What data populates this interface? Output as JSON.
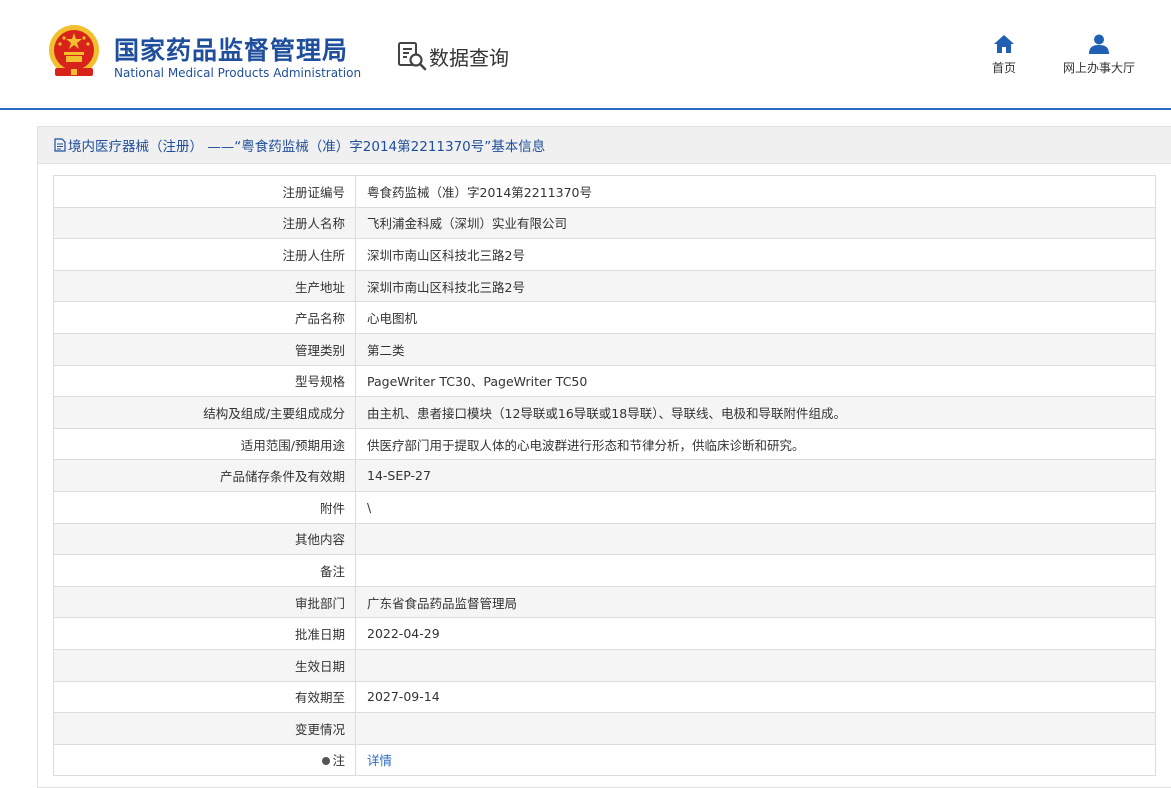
{
  "header": {
    "logo_cn": "国家药品监督管理局",
    "logo_en": "National Medical Products Administration",
    "query_title": "数据查询",
    "nav": [
      {
        "label": "首页",
        "icon": "home-icon"
      },
      {
        "label": "网上办事大厅",
        "icon": "user-icon"
      }
    ]
  },
  "colors": {
    "brand_blue": "#1f4e9c",
    "header_line": "#2a6bc2",
    "emblem_red": "#d8231a",
    "emblem_gold": "#f2c02e",
    "link": "#2a6bc2"
  },
  "panel": {
    "title": "境内医疗器械（注册） ——“粤食药监械（准）字2014第2211370号”基本信息"
  },
  "rows": [
    {
      "key": "注册证编号",
      "value": "粤食药监械（准）字2014第2211370号"
    },
    {
      "key": "注册人名称",
      "value": "飞利浦金科威（深圳）实业有限公司"
    },
    {
      "key": "注册人住所",
      "value": "深圳市南山区科技北三路2号"
    },
    {
      "key": "生产地址",
      "value": "深圳市南山区科技北三路2号"
    },
    {
      "key": "产品名称",
      "value": "心电图机"
    },
    {
      "key": "管理类别",
      "value": "第二类"
    },
    {
      "key": "型号规格",
      "value": "PageWriter TC30、PageWriter TC50"
    },
    {
      "key": "结构及组成/主要组成成分",
      "value": "由主机、患者接口模块（12导联或16导联或18导联）、导联线、电极和导联附件组成。"
    },
    {
      "key": "适用范围/预期用途",
      "value": "供医疗部门用于提取人体的心电波群进行形态和节律分析，供临床诊断和研究。"
    },
    {
      "key": "产品储存条件及有效期",
      "value": "14-SEP-27"
    },
    {
      "key": "附件",
      "value": "\\"
    },
    {
      "key": "其他内容",
      "value": ""
    },
    {
      "key": "备注",
      "value": ""
    },
    {
      "key": "审批部门",
      "value": "广东省食品药品监督管理局"
    },
    {
      "key": "批准日期",
      "value": "2022-04-29"
    },
    {
      "key": "生效日期",
      "value": ""
    },
    {
      "key": "有效期至",
      "value": "2027-09-14"
    },
    {
      "key": "变更情况",
      "value": ""
    }
  ],
  "note_row": {
    "key": "注",
    "link_label": "详情"
  }
}
